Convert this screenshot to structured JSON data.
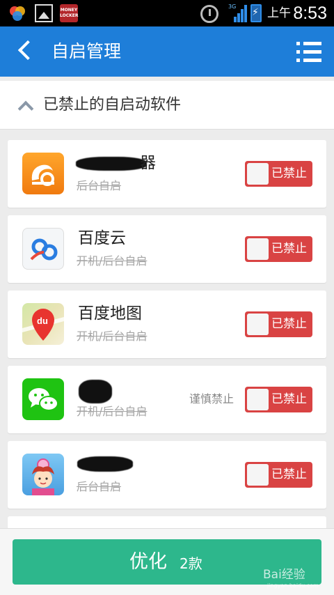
{
  "status_bar": {
    "ampm": "上午",
    "time": "8:53",
    "network": "3G",
    "app_label": "MONEY LOCKER"
  },
  "header": {
    "title": "自启管理",
    "back_icon": "chevron-left-icon",
    "menu_icon": "list-menu-icon"
  },
  "section": {
    "title": "已禁止的自启动软件"
  },
  "apps": [
    {
      "name": "器",
      "subtitle": "后台自启",
      "caution": "",
      "toggle_label": "已禁止",
      "icon": "uc-browser-icon"
    },
    {
      "name": "百度云",
      "subtitle": "开机/后台自启",
      "caution": "",
      "toggle_label": "已禁止",
      "icon": "baidu-cloud-icon"
    },
    {
      "name": "百度地图",
      "subtitle": "开机/后台自启",
      "caution": "",
      "toggle_label": "已禁止",
      "icon": "baidu-map-icon"
    },
    {
      "name": "",
      "subtitle": "开机/后台自启",
      "caution": "谨慎禁止",
      "toggle_label": "已禁止",
      "icon": "wechat-icon"
    },
    {
      "name": "",
      "subtitle": "后台自启",
      "caution": "",
      "toggle_label": "已禁止",
      "icon": "game-app-icon"
    }
  ],
  "footer": {
    "button_label": "优化",
    "count": "2款",
    "watermark": "Bai经验",
    "watermark_url": "jingyan.baidu.com"
  },
  "colors": {
    "primary_blue": "#1e7ed9",
    "toggle_red": "#d94343",
    "button_green": "#2db78c"
  }
}
